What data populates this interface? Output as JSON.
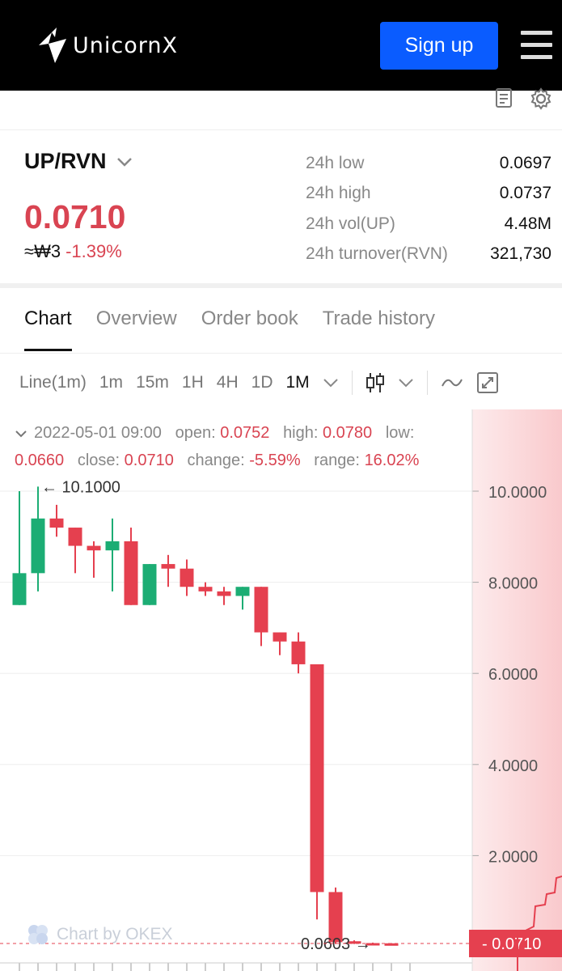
{
  "header": {
    "brand": "UnicornX",
    "signup_label": "Sign up"
  },
  "icons": {
    "logo": "unicorn-logo-icon",
    "menu": "hamburger-menu-icon",
    "notes": "document-icon",
    "settings": "gear-icon"
  },
  "ticker": {
    "pair": "UP/RVN",
    "price": "0.0710",
    "approx": "≈₩3",
    "change": "-1.39%",
    "stats": [
      {
        "label": "24h low",
        "value": "0.0697"
      },
      {
        "label": "24h high",
        "value": "0.0737"
      },
      {
        "label": "24h vol(UP)",
        "value": "4.48M"
      },
      {
        "label": "24h turnover(RVN)",
        "value": "321,730"
      }
    ]
  },
  "tabs": [
    "Chart",
    "Overview",
    "Order book",
    "Trade history"
  ],
  "intervals": [
    "Line(1m)",
    "1m",
    "15m",
    "1H",
    "4H",
    "1D",
    "1M"
  ],
  "info": {
    "datetime": "2022-05-01 09:00",
    "open_label": "open:",
    "open": "0.0752",
    "high_label": "high:",
    "high": "0.0780",
    "low_label": "low:",
    "low": "0.0660",
    "close_label": "close:",
    "close": "0.0710",
    "change_label": "change:",
    "change": "-5.59%",
    "range_label": "range:",
    "range": "16.02%"
  },
  "watermark": "Chart by OKEX",
  "colors": {
    "up": "#1cad74",
    "down": "#e5404f",
    "accent": "#0a5cff"
  },
  "chart_data": {
    "type": "candlestick",
    "y_ticks": [
      "10.0000",
      "8.0000",
      "6.0000",
      "4.0000",
      "2.0000"
    ],
    "ylim": [
      0,
      11
    ],
    "max_label": "10.1000",
    "min_label": "0.0603",
    "last_price": "0.0710",
    "candles": [
      {
        "o": 7.5,
        "c": 8.2,
        "h": 10.0,
        "l": 7.5
      },
      {
        "o": 8.2,
        "c": 9.4,
        "h": 10.1,
        "l": 7.8
      },
      {
        "o": 9.4,
        "c": 9.2,
        "h": 9.7,
        "l": 9.0
      },
      {
        "o": 9.2,
        "c": 8.8,
        "h": 9.2,
        "l": 8.2
      },
      {
        "o": 8.8,
        "c": 8.7,
        "h": 8.9,
        "l": 8.1
      },
      {
        "o": 8.7,
        "c": 8.9,
        "h": 9.4,
        "l": 7.8
      },
      {
        "o": 8.9,
        "c": 7.5,
        "h": 9.2,
        "l": 7.5
      },
      {
        "o": 7.5,
        "c": 8.4,
        "h": 8.4,
        "l": 7.5
      },
      {
        "o": 8.4,
        "c": 8.3,
        "h": 8.6,
        "l": 7.9
      },
      {
        "o": 8.3,
        "c": 7.9,
        "h": 8.5,
        "l": 7.7
      },
      {
        "o": 7.9,
        "c": 7.8,
        "h": 8.0,
        "l": 7.7
      },
      {
        "o": 7.8,
        "c": 7.7,
        "h": 7.9,
        "l": 7.5
      },
      {
        "o": 7.7,
        "c": 7.9,
        "h": 7.9,
        "l": 7.4
      },
      {
        "o": 7.9,
        "c": 6.9,
        "h": 7.9,
        "l": 6.6
      },
      {
        "o": 6.9,
        "c": 6.7,
        "h": 6.9,
        "l": 6.4
      },
      {
        "o": 6.7,
        "c": 6.2,
        "h": 6.9,
        "l": 6.0
      },
      {
        "o": 6.2,
        "c": 1.2,
        "h": 6.2,
        "l": 0.6
      },
      {
        "o": 1.2,
        "c": 0.1,
        "h": 1.3,
        "l": 0.06
      },
      {
        "o": 0.12,
        "c": 0.08,
        "h": 0.14,
        "l": 0.06
      },
      {
        "o": 0.08,
        "c": 0.075,
        "h": 0.09,
        "l": 0.06
      },
      {
        "o": 0.075,
        "c": 0.071,
        "h": 0.08,
        "l": 0.066
      }
    ],
    "grid": true
  }
}
